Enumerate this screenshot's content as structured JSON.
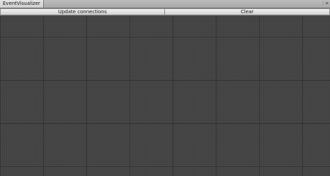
{
  "window": {
    "tab_title": "EventVisualizer",
    "tab_menu_icon": "tab-options-icon"
  },
  "toolbar": {
    "update_label": "Update connections",
    "clear_label": "Clear"
  },
  "canvas": {
    "style": "grid",
    "background_color": "#474747",
    "minor_grid_color": "#464646",
    "major_grid_color": "#1e1e1e"
  }
}
